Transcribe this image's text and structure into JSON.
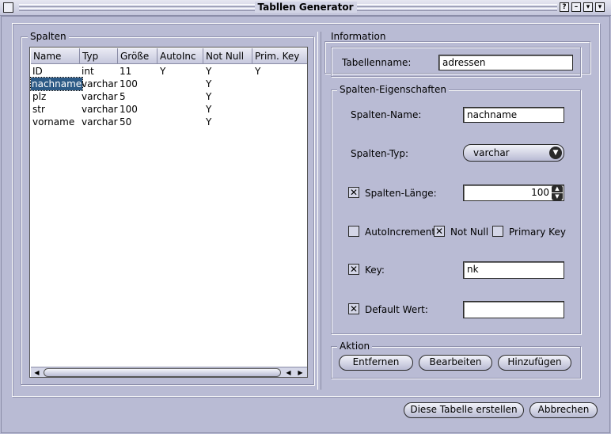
{
  "window": {
    "title": "Tabllen Generator",
    "buttons": [
      "?",
      "–",
      "▾",
      "▾"
    ]
  },
  "columns_panel": {
    "legend": "Spalten",
    "headers": [
      "Name",
      "Typ",
      "Größe",
      "AutoInc",
      "Not Null",
      "Prim. Key"
    ],
    "rows": [
      [
        "ID",
        "int",
        "11",
        "Y",
        "Y",
        "Y"
      ],
      [
        "nachname",
        "varchar",
        "100",
        "",
        "Y",
        ""
      ],
      [
        "plz",
        "varchar",
        "5",
        "",
        "Y",
        ""
      ],
      [
        "str",
        "varchar",
        "100",
        "",
        "Y",
        ""
      ],
      [
        "vorname",
        "varchar",
        "50",
        "",
        "Y",
        ""
      ]
    ],
    "selected_row": 1
  },
  "information": {
    "legend": "Information",
    "table_name_label": "Tabellenname:",
    "table_name_value": "adressen"
  },
  "column_props": {
    "legend": "Spalten-Eigenschaften",
    "name_label": "Spalten-Name:",
    "name_value": "nachname",
    "type_label": "Spalten-Typ:",
    "type_value": "varchar",
    "length_label": "Spalten-Länge:",
    "length_checked": true,
    "length_value": "100",
    "autoinc_label": "AutoIncrement",
    "autoinc_checked": false,
    "notnull_label": "Not Null",
    "notnull_checked": true,
    "primary_label": "Primary Key",
    "primary_checked": false,
    "key_label": "Key:",
    "key_checked": true,
    "key_value": "nk",
    "default_label": "Default Wert:",
    "default_checked": true,
    "default_value": ""
  },
  "actions": {
    "legend": "Aktion",
    "remove": "Entfernen",
    "edit": "Bearbeiten",
    "add": "Hinzufügen"
  },
  "footer": {
    "create": "Diese Tabelle erstellen",
    "cancel": "Abbrechen"
  },
  "icons": {
    "check_mark": "✕",
    "dropdown": "chevron-down-icon"
  }
}
